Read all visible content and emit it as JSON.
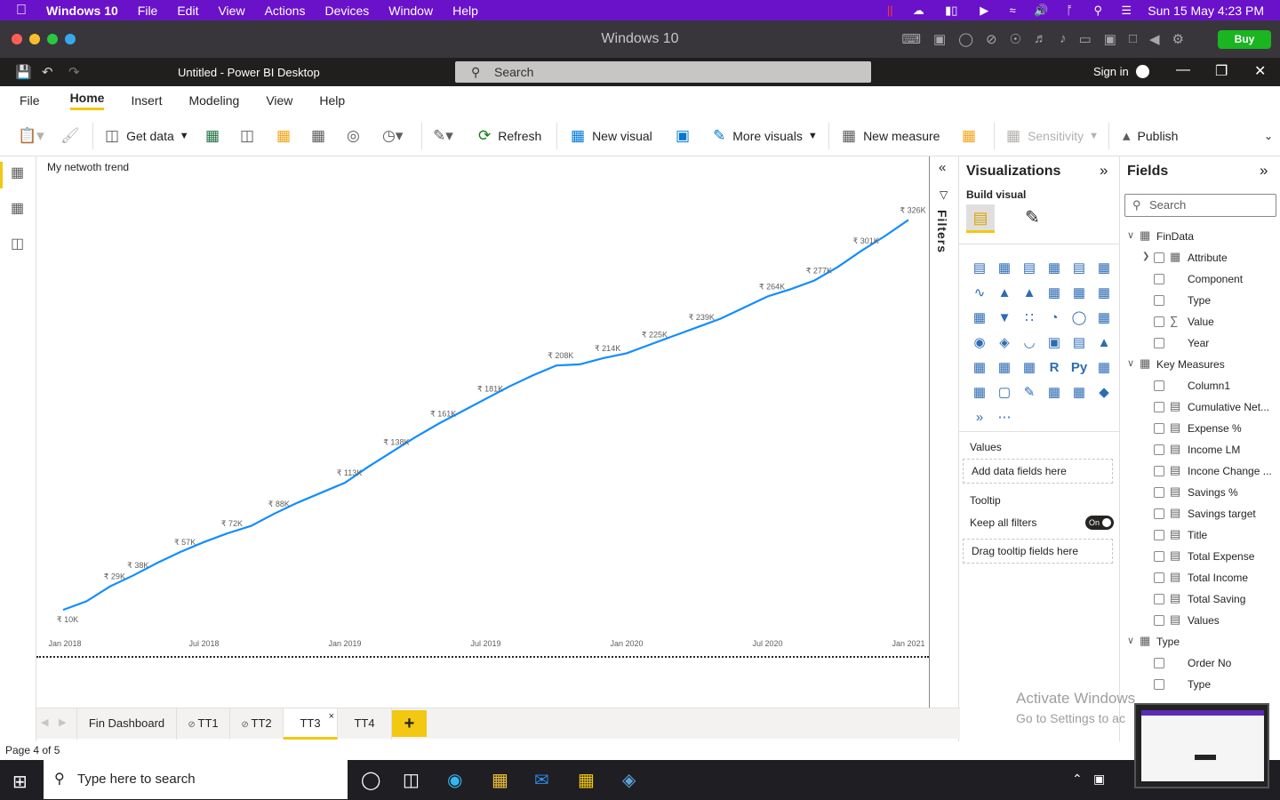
{
  "mac_menu": {
    "app": "Windows 10",
    "items": [
      "File",
      "Edit",
      "View",
      "Actions",
      "Devices",
      "Window",
      "Help"
    ],
    "datetime": "Sun 15 May  4:23 PM"
  },
  "vm": {
    "title": "Windows 10",
    "buy_label": "Buy"
  },
  "titlebar": {
    "doc_title": "Untitled - Power BI Desktop",
    "search_placeholder": "Search",
    "sign_in": "Sign in"
  },
  "menu_tabs": [
    "File",
    "Home",
    "Insert",
    "Modeling",
    "View",
    "Help"
  ],
  "ribbon": {
    "get_data": "Get data",
    "refresh": "Refresh",
    "new_visual": "New visual",
    "more_visuals": "More visuals",
    "new_measure": "New measure",
    "sensitivity": "Sensitivity",
    "publish": "Publish"
  },
  "chart_title": "My netwoth trend",
  "chart_data": {
    "type": "line",
    "title": "My netwoth trend",
    "x_ticks": [
      "Jan 2018",
      "Jul 2018",
      "Jan 2019",
      "Jul 2019",
      "Jan 2020",
      "Jul 2020",
      "Jan 2021"
    ],
    "x": [
      "2018-01",
      "2018-02",
      "2018-03",
      "2018-04",
      "2018-05",
      "2018-06",
      "2018-07",
      "2018-08",
      "2018-09",
      "2018-10",
      "2018-11",
      "2018-12",
      "2019-01",
      "2019-02",
      "2019-03",
      "2019-04",
      "2019-05",
      "2019-06",
      "2019-07",
      "2019-08",
      "2019-09",
      "2019-10",
      "2019-11",
      "2019-12",
      "2020-01",
      "2020-02",
      "2020-03",
      "2020-04",
      "2020-05",
      "2020-06",
      "2020-07",
      "2020-08",
      "2020-09",
      "2020-10",
      "2020-11",
      "2020-12",
      "2021-01"
    ],
    "values": [
      10,
      17,
      29,
      38,
      48,
      57,
      65,
      72,
      78,
      88,
      97,
      105,
      113,
      126,
      138,
      150,
      161,
      171,
      181,
      191,
      200,
      208,
      209,
      214,
      218,
      225,
      232,
      239,
      246,
      255,
      264,
      270,
      277,
      288,
      301,
      313,
      326
    ],
    "data_labels": [
      "₹ 10K",
      null,
      "₹ 29K",
      "₹ 38K",
      null,
      "₹ 57K",
      null,
      "₹ 72K",
      null,
      "₹ 88K",
      null,
      null,
      "₹ 113K",
      null,
      "₹ 138K",
      null,
      "₹ 161K",
      null,
      "₹ 181K",
      null,
      null,
      "₹ 208K",
      null,
      "₹ 214K",
      null,
      "₹ 225K",
      null,
      "₹ 239K",
      null,
      null,
      "₹ 264K",
      null,
      "₹ 277K",
      null,
      "₹ 301K",
      null,
      "₹ 326K"
    ],
    "ylim": [
      0,
      340
    ],
    "color": "#118dff"
  },
  "filters_label": "Filters",
  "viz": {
    "title": "Visualizations",
    "build_visual": "Build visual",
    "values_label": "Values",
    "values_well": "Add data fields here",
    "tooltip_label": "Tooltip",
    "keep_filters": "Keep all filters",
    "toggle": "On",
    "tooltip_well": "Drag tooltip fields here"
  },
  "fields": {
    "title": "Fields",
    "search_placeholder": "Search",
    "tables": [
      {
        "name": "FinData",
        "items": [
          {
            "label": "Attribute",
            "icon": "hierarchy-icon"
          },
          {
            "label": "Component",
            "icon": ""
          },
          {
            "label": "Type",
            "icon": ""
          },
          {
            "label": "Value",
            "icon": "sigma-icon"
          },
          {
            "label": "Year",
            "icon": ""
          }
        ]
      },
      {
        "name": "Key Measures",
        "items": [
          {
            "label": "Column1",
            "icon": ""
          },
          {
            "label": "Cumulative Net...",
            "icon": "measure-icon"
          },
          {
            "label": "Expense %",
            "icon": "measure-icon"
          },
          {
            "label": "Income LM",
            "icon": "measure-icon"
          },
          {
            "label": "Incone Change ...",
            "icon": "measure-icon"
          },
          {
            "label": "Savings %",
            "icon": "measure-icon"
          },
          {
            "label": "Savings target",
            "icon": "measure-icon"
          },
          {
            "label": "Title",
            "icon": "measure-icon"
          },
          {
            "label": "Total Expense",
            "icon": "measure-icon"
          },
          {
            "label": "Total Income",
            "icon": "measure-icon"
          },
          {
            "label": "Total Saving",
            "icon": "measure-icon"
          },
          {
            "label": "Values",
            "icon": "measure-icon"
          }
        ]
      },
      {
        "name": "Type",
        "items": [
          {
            "label": "Order No",
            "icon": ""
          },
          {
            "label": "Type",
            "icon": ""
          }
        ]
      }
    ]
  },
  "page_tabs": [
    {
      "label": "Fin Dashboard",
      "hidden": false
    },
    {
      "label": "TT1",
      "hidden": true
    },
    {
      "label": "TT2",
      "hidden": true
    },
    {
      "label": "TT3",
      "hidden": false,
      "active": true
    },
    {
      "label": "TT4",
      "hidden": false
    }
  ],
  "status": "Page 4 of 5",
  "activate": {
    "line1": "Activate Windows",
    "line2": "Go to Settings to ac"
  },
  "taskbar": {
    "search_placeholder": "Type here to search"
  }
}
